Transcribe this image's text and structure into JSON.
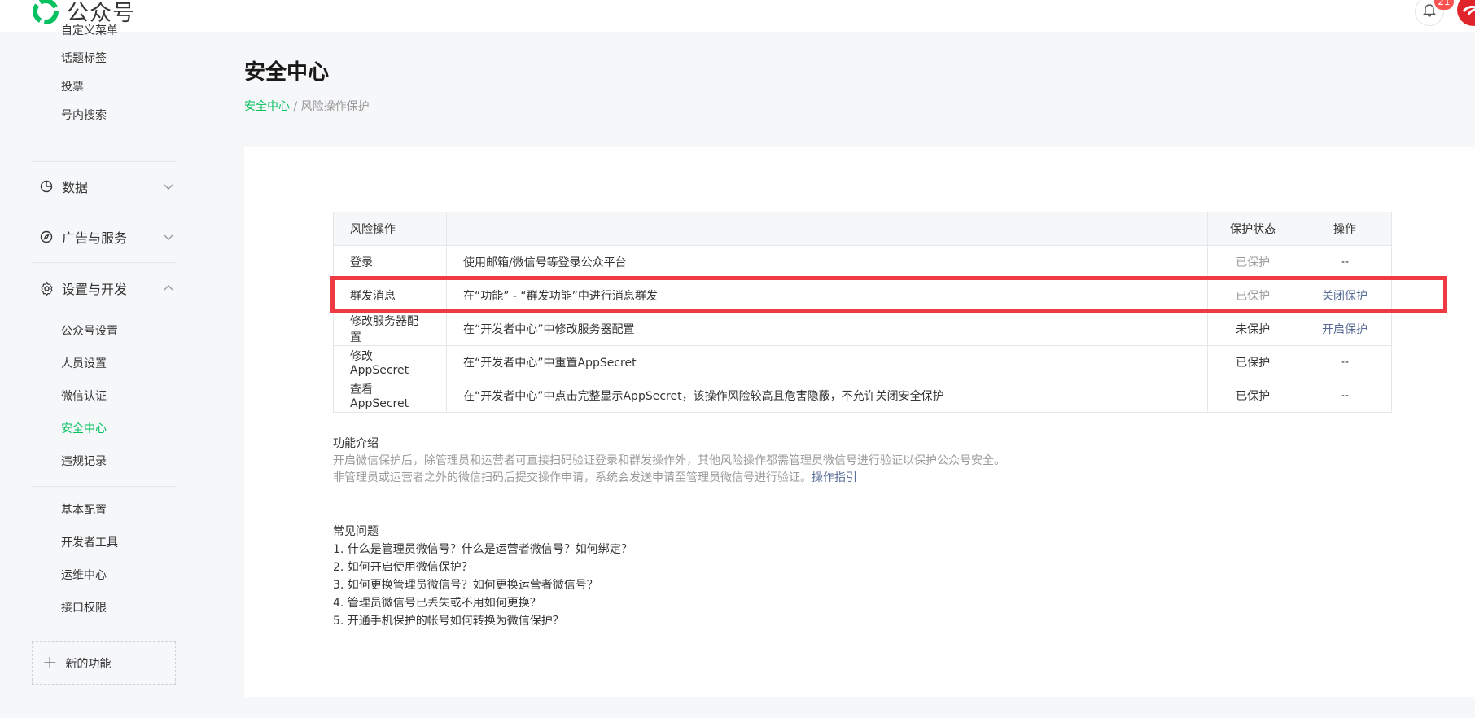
{
  "header": {
    "brand": "公众号",
    "notification_count": "21"
  },
  "sidebar": {
    "partial_item": "自定义菜单",
    "feature_items": [
      "话题标签",
      "投票",
      "号内搜索"
    ],
    "groups": [
      {
        "label": "数据",
        "icon": "pie-chart-icon",
        "expanded": false
      },
      {
        "label": "广告与服务",
        "icon": "compass-icon",
        "expanded": false
      },
      {
        "label": "设置与开发",
        "icon": "gear-icon",
        "expanded": true
      }
    ],
    "settings_items": [
      "公众号设置",
      "人员设置",
      "微信认证",
      "安全中心",
      "违规记录"
    ],
    "active_item": "安全中心",
    "dev_items": [
      "基本配置",
      "开发者工具",
      "运维中心",
      "接口权限"
    ],
    "new_feature": "新的功能"
  },
  "page": {
    "title": "安全中心",
    "breadcrumb_root": "安全中心",
    "breadcrumb_sep": " / ",
    "breadcrumb_current": "风险操作保护"
  },
  "table": {
    "headers": [
      "风险操作",
      "",
      "保护状态",
      "操作"
    ],
    "rows": [
      {
        "op": "登录",
        "desc": "使用邮箱/微信号等登录公众平台",
        "status": "已保护",
        "action": "--"
      },
      {
        "op": "群发消息",
        "desc": "在“功能” - “群发功能”中进行消息群发",
        "status": "已保护",
        "action": "关闭保护"
      },
      {
        "op": "修改服务器配置",
        "desc": "在“开发者中心”中修改服务器配置",
        "status": "未保护",
        "action": "开启保护"
      },
      {
        "op": "修改AppSecret",
        "desc": "在“开发者中心”中重置AppSecret",
        "status": "已保护",
        "action": "--"
      },
      {
        "op": "查看AppSecret",
        "desc": "在“开发者中心”中点击完整显示AppSecret，该操作风险较高且危害隐蔽，不允许关闭安全保护",
        "status": "已保护",
        "action": "--"
      }
    ]
  },
  "intro": {
    "heading": "功能介绍",
    "line1": "开启微信保护后，除管理员和运营者可直接扫码验证登录和群发操作外，其他风险操作都需管理员微信号进行验证以保护公众号安全。",
    "line2": "非管理员或运营者之外的微信扫码后提交操作申请，系统会发送申请至管理员微信号进行验证。",
    "guide_link": "操作指引"
  },
  "faq": {
    "heading": "常见问题",
    "items": [
      "1. 什么是管理员微信号？什么是运营者微信号？如何绑定？",
      "2. 如何开启使用微信保护？",
      "3. 如何更换管理员微信号？如何更换运营者微信号？",
      "4. 管理员微信号已丢失或不用如何更换？",
      "5. 开通手机保护的帐号如何转换为微信保护？"
    ]
  },
  "colors": {
    "accent": "#07c160",
    "link": "#576b95",
    "highlight": "#ee3a43",
    "badge": "#fa5151"
  }
}
